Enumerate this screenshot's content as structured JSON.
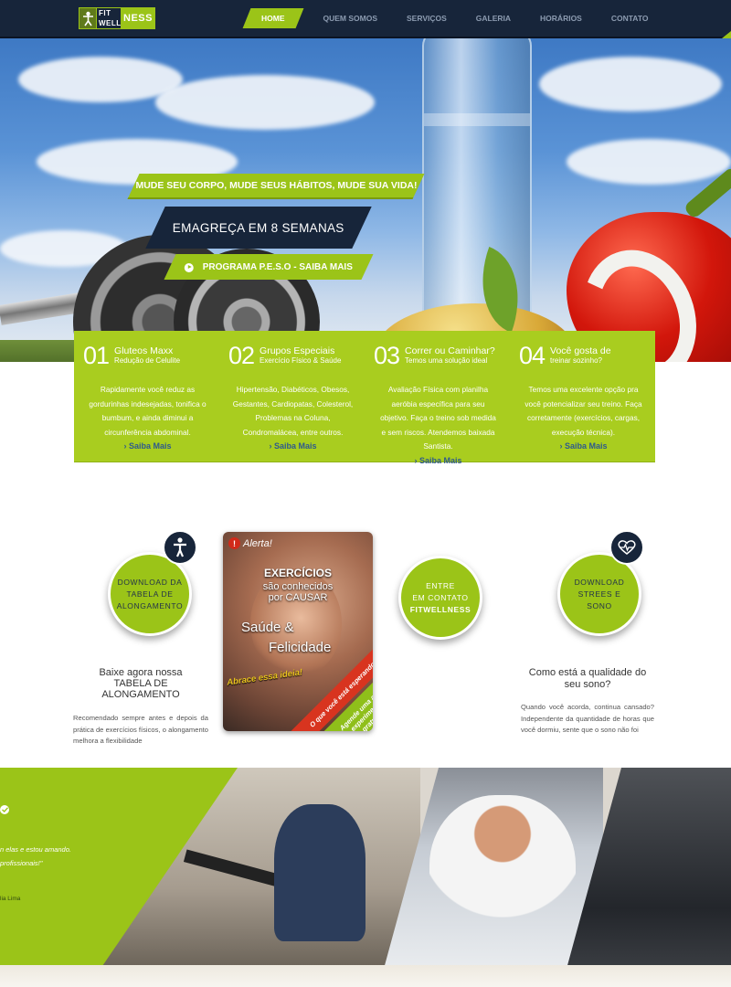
{
  "brand": {
    "logo_fit": "FIT",
    "logo_well": "WELL",
    "logo_ness": "NESS",
    "colors": {
      "green": "#9bc418",
      "navy": "#17253a"
    }
  },
  "nav": {
    "items": [
      "HOME",
      "QUEM SOMOS",
      "SERVIÇOS",
      "GALERIA",
      "HORÁRIOS",
      "CONTATO"
    ]
  },
  "hero": {
    "banner1": "MUDE SEU CORPO, MUDE SEUS HÁBITOS, MUDE SUA VIDA!",
    "banner2": "EMAGREÇA EM 8 SEMANAS",
    "banner3": "PROGRAMA P.E.S.O - SAIBA MAIS"
  },
  "features": [
    {
      "num": "01",
      "title": "Gluteos Maxx",
      "subtitle": "Redução de Celulite",
      "text": "Rapidamente você reduz as gordurinhas indesejadas, tonifica o bumbum, e ainda diminui a circunferência abdominal.",
      "link": "› Saiba Mais"
    },
    {
      "num": "02",
      "title": "Grupos Especiais",
      "subtitle": "Exercício Físico & Saúde",
      "text": "Hipertensão, Diabéticos, Obesos, Gestantes, Cardiopatas, Colesterol, Problemas na Coluna, Condromalácea, entre outros.",
      "link": "› Saiba Mais"
    },
    {
      "num": "03",
      "title": "Correr ou Caminhar?",
      "subtitle": "Temos uma solução ideal",
      "text": "Avaliação Física com planilha aeróbia específica para seu objetivo. Faça o treino sob medida e sem riscos. Atendemos baixada Santista.",
      "link": "› Saiba Mais"
    },
    {
      "num": "04",
      "title": "Você gosta de",
      "subtitle": "treinar sozinho?",
      "text": "Temos uma excelente opção pra você potencializar seu treino. Faça corretamente (exercícios, cargas, execução técnica).",
      "link": "› Saiba Mais"
    }
  ],
  "middle": {
    "circle1": [
      "DOWNLOAD DA",
      "TABELA DE",
      "ALONGAMENTO"
    ],
    "circle2": [
      "ENTRE",
      "EM CONTATO",
      "FITWELLNESS"
    ],
    "circle3": [
      "DOWNLOAD",
      "STREES E",
      "SONO"
    ],
    "colA_title": [
      "Baixe agora nossa",
      "TABELA DE",
      "ALONGAMENTO"
    ],
    "colA_text": "Recomendado sempre antes e depois da prática de exercícios físicos, o alongamento melhora a flexibilidade",
    "colC_title": [
      "Como está a qualidade do",
      "seu sono?"
    ],
    "colC_text": "Quando você acorda, continua cansado? Independente da quantidade de horas que você dormiu, sente que o sono não foi",
    "poster": {
      "alert": "Alerta!",
      "line1": "EXERCÍCIOS",
      "line2": "são conhecidos",
      "line3": "por CAUSAR",
      "line4": "Saúde &",
      "line5": "Felicidade",
      "line6": "Abrace essa ideia!",
      "ribbon": "O que você está esperando?",
      "ribbon2a": "Agende uma aula",
      "ribbon2b": "experimental",
      "ribbon2c": "gratuita."
    }
  },
  "testimonial": {
    "quote_line1": "n elas e estou amando.",
    "quote_line2": "profissionais!\"",
    "author": "lia Lima"
  }
}
